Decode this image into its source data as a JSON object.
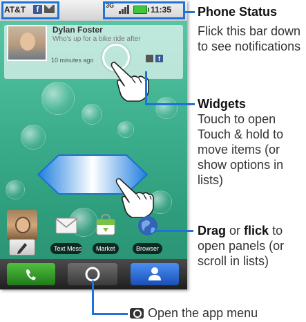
{
  "status_bar": {
    "carrier": "AT&T",
    "facebook_glyph": "f",
    "network_type": "3G",
    "time": "11:35"
  },
  "widget": {
    "contact_name": "Dylan Foster",
    "message": "Who's up for a bike ride after",
    "timestamp": "10 minutes ago",
    "facebook_glyph": "f"
  },
  "apps": [
    {
      "label": "Text Messa",
      "icon": "message-envelope-icon"
    },
    {
      "label": "Market",
      "icon": "market-bag-icon"
    },
    {
      "label": "Browser",
      "icon": "browser-globe-icon"
    }
  ],
  "nav": {
    "phone_icon": "phone-icon",
    "home_icon": "home-circle-icon",
    "contacts_icon": "contacts-icon"
  },
  "annotations": {
    "phone_status": {
      "title": "Phone Status",
      "body": "Flick this bar down to see notifications"
    },
    "widgets": {
      "title": "Widgets",
      "body": "Touch to open Touch & hold to move items (or show options in lists)"
    },
    "drag": {
      "drag": "Drag",
      "or": " or ",
      "flick": "flick",
      "rest": " to open panels (or scroll in lists)"
    },
    "app_menu": {
      "text": "Open the app menu",
      "icon": "camera-key-icon"
    }
  },
  "colors": {
    "callout_blue": "#1e73d8",
    "wallpaper_green": "#43b593",
    "facebook_blue": "#3b5998"
  }
}
